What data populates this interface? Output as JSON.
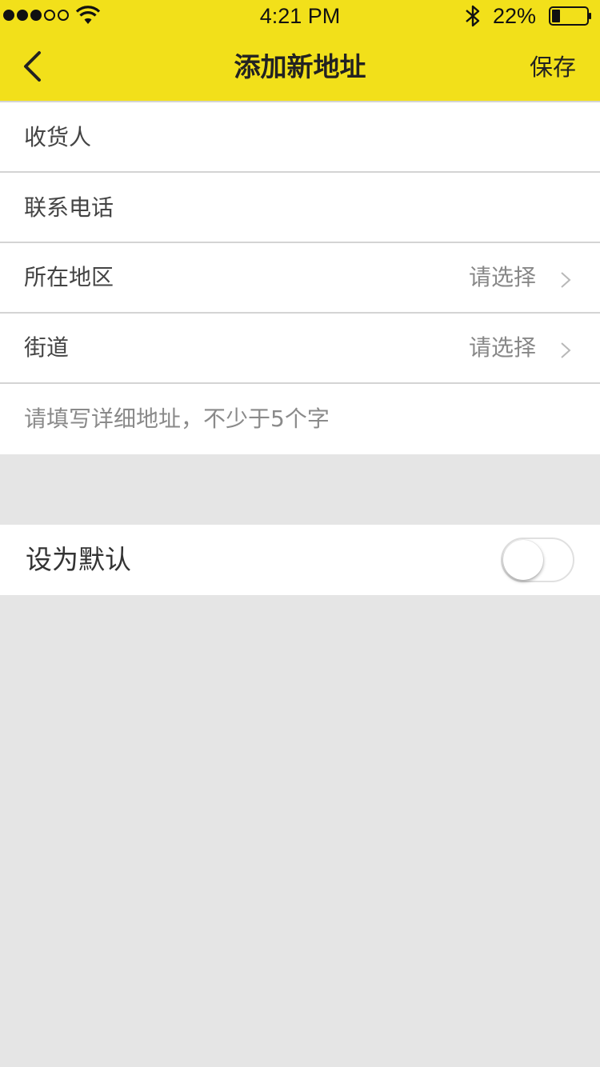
{
  "status_bar": {
    "time": "4:21 PM",
    "battery": "22%",
    "signal_dots_filled": 3,
    "signal_dots_total": 5,
    "icons": [
      "signal-icon",
      "wifi-icon",
      "bluetooth-icon",
      "battery-icon"
    ]
  },
  "nav": {
    "title": "添加新地址",
    "save_label": "保存",
    "back_icon": "chevron-left-icon",
    "bar_color": "#f2e01a"
  },
  "form": {
    "recipient_placeholder": "收货人",
    "phone_placeholder": "联系电话",
    "region": {
      "label": "所在地区",
      "value": "请选择"
    },
    "street": {
      "label": "街道",
      "value": "请选择"
    },
    "detail_placeholder": "请填写详细地址，不少于5个字"
  },
  "default_setting": {
    "label": "设为默认",
    "enabled": false
  }
}
